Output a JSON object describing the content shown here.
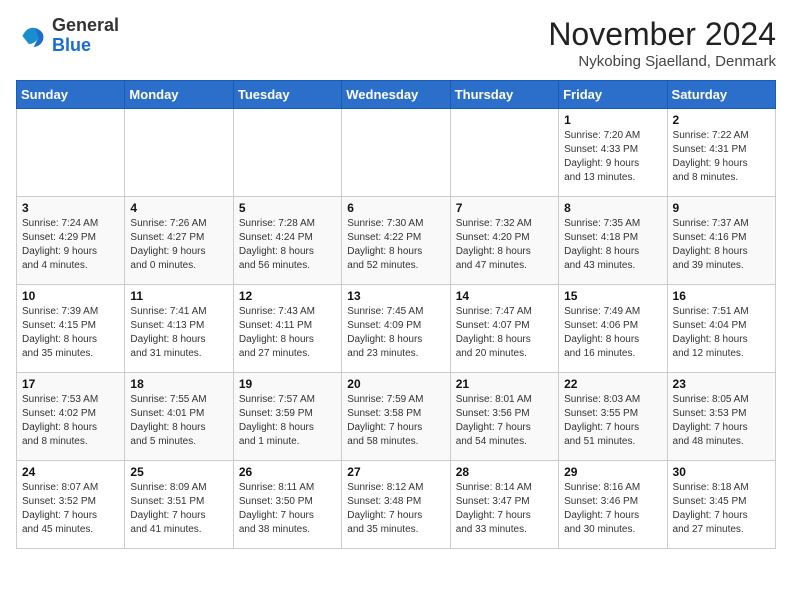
{
  "logo": {
    "general": "General",
    "blue": "Blue"
  },
  "header": {
    "month": "November 2024",
    "location": "Nykobing Sjaelland, Denmark"
  },
  "days_of_week": [
    "Sunday",
    "Monday",
    "Tuesday",
    "Wednesday",
    "Thursday",
    "Friday",
    "Saturday"
  ],
  "weeks": [
    [
      {
        "day": "",
        "info": ""
      },
      {
        "day": "",
        "info": ""
      },
      {
        "day": "",
        "info": ""
      },
      {
        "day": "",
        "info": ""
      },
      {
        "day": "",
        "info": ""
      },
      {
        "day": "1",
        "info": "Sunrise: 7:20 AM\nSunset: 4:33 PM\nDaylight: 9 hours\nand 13 minutes."
      },
      {
        "day": "2",
        "info": "Sunrise: 7:22 AM\nSunset: 4:31 PM\nDaylight: 9 hours\nand 8 minutes."
      }
    ],
    [
      {
        "day": "3",
        "info": "Sunrise: 7:24 AM\nSunset: 4:29 PM\nDaylight: 9 hours\nand 4 minutes."
      },
      {
        "day": "4",
        "info": "Sunrise: 7:26 AM\nSunset: 4:27 PM\nDaylight: 9 hours\nand 0 minutes."
      },
      {
        "day": "5",
        "info": "Sunrise: 7:28 AM\nSunset: 4:24 PM\nDaylight: 8 hours\nand 56 minutes."
      },
      {
        "day": "6",
        "info": "Sunrise: 7:30 AM\nSunset: 4:22 PM\nDaylight: 8 hours\nand 52 minutes."
      },
      {
        "day": "7",
        "info": "Sunrise: 7:32 AM\nSunset: 4:20 PM\nDaylight: 8 hours\nand 47 minutes."
      },
      {
        "day": "8",
        "info": "Sunrise: 7:35 AM\nSunset: 4:18 PM\nDaylight: 8 hours\nand 43 minutes."
      },
      {
        "day": "9",
        "info": "Sunrise: 7:37 AM\nSunset: 4:16 PM\nDaylight: 8 hours\nand 39 minutes."
      }
    ],
    [
      {
        "day": "10",
        "info": "Sunrise: 7:39 AM\nSunset: 4:15 PM\nDaylight: 8 hours\nand 35 minutes."
      },
      {
        "day": "11",
        "info": "Sunrise: 7:41 AM\nSunset: 4:13 PM\nDaylight: 8 hours\nand 31 minutes."
      },
      {
        "day": "12",
        "info": "Sunrise: 7:43 AM\nSunset: 4:11 PM\nDaylight: 8 hours\nand 27 minutes."
      },
      {
        "day": "13",
        "info": "Sunrise: 7:45 AM\nSunset: 4:09 PM\nDaylight: 8 hours\nand 23 minutes."
      },
      {
        "day": "14",
        "info": "Sunrise: 7:47 AM\nSunset: 4:07 PM\nDaylight: 8 hours\nand 20 minutes."
      },
      {
        "day": "15",
        "info": "Sunrise: 7:49 AM\nSunset: 4:06 PM\nDaylight: 8 hours\nand 16 minutes."
      },
      {
        "day": "16",
        "info": "Sunrise: 7:51 AM\nSunset: 4:04 PM\nDaylight: 8 hours\nand 12 minutes."
      }
    ],
    [
      {
        "day": "17",
        "info": "Sunrise: 7:53 AM\nSunset: 4:02 PM\nDaylight: 8 hours\nand 8 minutes."
      },
      {
        "day": "18",
        "info": "Sunrise: 7:55 AM\nSunset: 4:01 PM\nDaylight: 8 hours\nand 5 minutes."
      },
      {
        "day": "19",
        "info": "Sunrise: 7:57 AM\nSunset: 3:59 PM\nDaylight: 8 hours\nand 1 minute."
      },
      {
        "day": "20",
        "info": "Sunrise: 7:59 AM\nSunset: 3:58 PM\nDaylight: 7 hours\nand 58 minutes."
      },
      {
        "day": "21",
        "info": "Sunrise: 8:01 AM\nSunset: 3:56 PM\nDaylight: 7 hours\nand 54 minutes."
      },
      {
        "day": "22",
        "info": "Sunrise: 8:03 AM\nSunset: 3:55 PM\nDaylight: 7 hours\nand 51 minutes."
      },
      {
        "day": "23",
        "info": "Sunrise: 8:05 AM\nSunset: 3:53 PM\nDaylight: 7 hours\nand 48 minutes."
      }
    ],
    [
      {
        "day": "24",
        "info": "Sunrise: 8:07 AM\nSunset: 3:52 PM\nDaylight: 7 hours\nand 45 minutes."
      },
      {
        "day": "25",
        "info": "Sunrise: 8:09 AM\nSunset: 3:51 PM\nDaylight: 7 hours\nand 41 minutes."
      },
      {
        "day": "26",
        "info": "Sunrise: 8:11 AM\nSunset: 3:50 PM\nDaylight: 7 hours\nand 38 minutes."
      },
      {
        "day": "27",
        "info": "Sunrise: 8:12 AM\nSunset: 3:48 PM\nDaylight: 7 hours\nand 35 minutes."
      },
      {
        "day": "28",
        "info": "Sunrise: 8:14 AM\nSunset: 3:47 PM\nDaylight: 7 hours\nand 33 minutes."
      },
      {
        "day": "29",
        "info": "Sunrise: 8:16 AM\nSunset: 3:46 PM\nDaylight: 7 hours\nand 30 minutes."
      },
      {
        "day": "30",
        "info": "Sunrise: 8:18 AM\nSunset: 3:45 PM\nDaylight: 7 hours\nand 27 minutes."
      }
    ]
  ]
}
